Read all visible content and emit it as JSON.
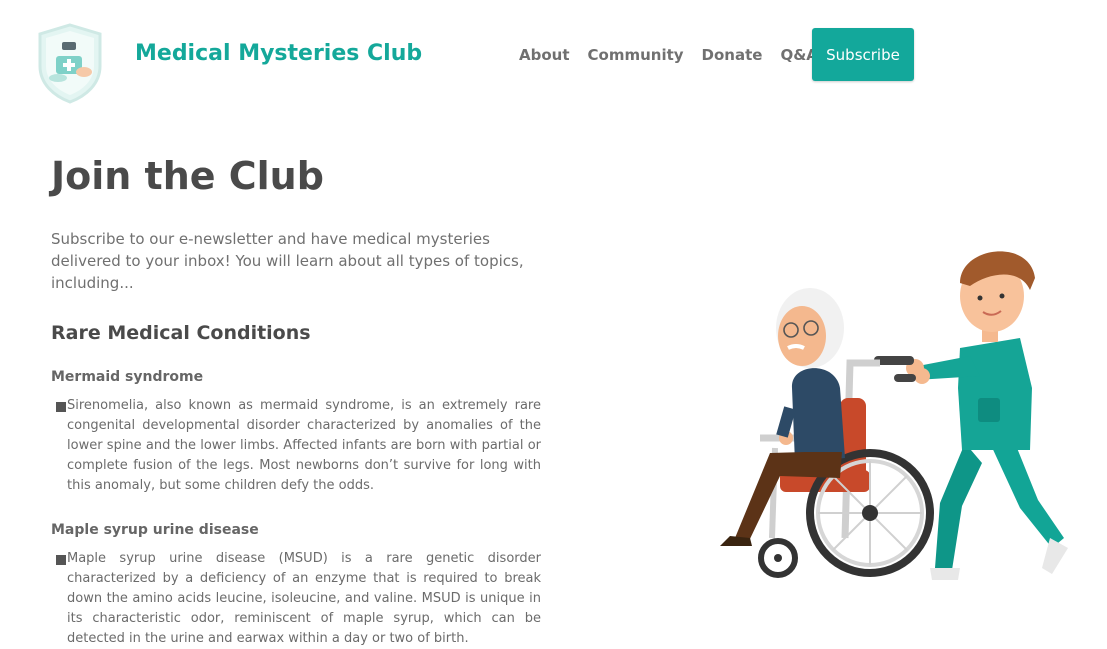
{
  "header": {
    "site_title": "Medical Mysteries Club",
    "logo_icon": "medical-shield-logo-icon",
    "nav": [
      {
        "label": "About"
      },
      {
        "label": "Community"
      },
      {
        "label": "Donate"
      },
      {
        "label": "Q&A"
      }
    ],
    "subscribe_label": "Subscribe"
  },
  "main": {
    "title": "Join the Club",
    "intro": "Subscribe to our e-newsletter and have medical mysteries delivered to your inbox! You will learn about all types of topics, including...",
    "section_title": "Rare Medical Conditions",
    "conditions": [
      {
        "name": "Mermaid syndrome",
        "description": "Sirenomelia, also known as mermaid syndrome, is an extremely rare congenital developmental disorder characterized by anomalies of the lower spine and the lower limbs. Affected infants are born with partial or complete fusion of the legs. Most newborns don’t survive for long with this anomaly, but some children defy the odds."
      },
      {
        "name": "Maple syrup urine disease",
        "description": "Maple syrup urine disease (MSUD) is a rare genetic disorder characterized by a deficiency of an enzyme that is required to break down the amino acids leucine, isoleucine, and valine. MSUD is unique in its characteristic odor, reminiscent of maple syrup, which can be detected in the urine and earwax within a day or two of birth."
      }
    ]
  },
  "illustration_icon": "nurse-pushing-wheelchair-illustration",
  "colors": {
    "accent": "#14a89a",
    "heading": "#4a4a4a",
    "body_text": "#707070"
  }
}
